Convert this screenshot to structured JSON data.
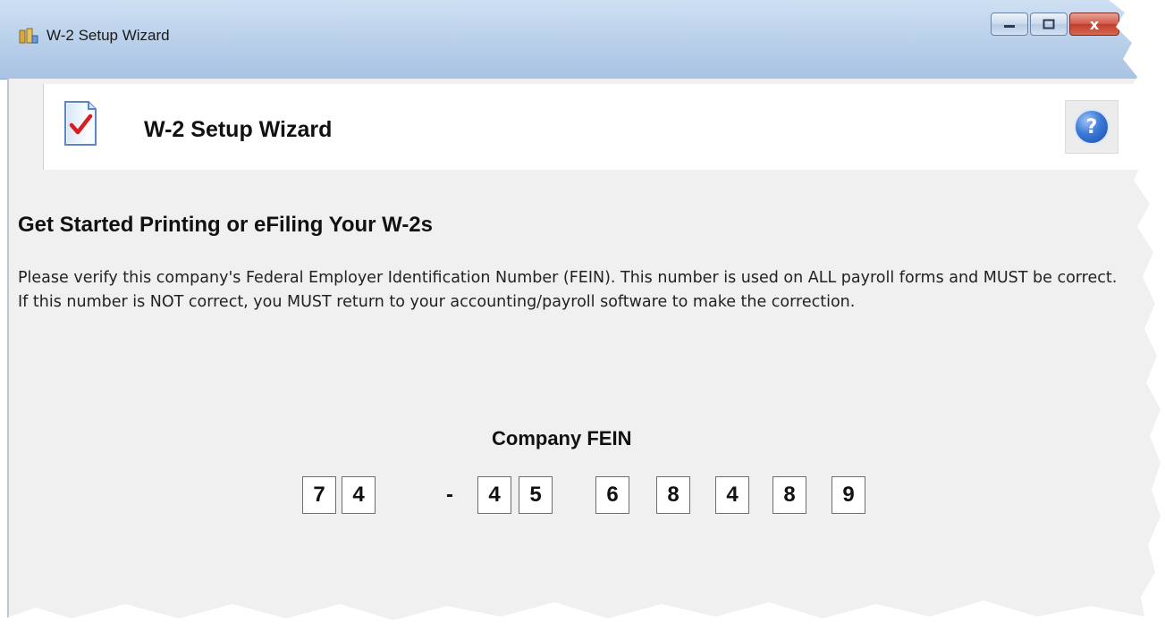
{
  "window": {
    "title": "W-2 Setup Wizard",
    "close_glyph": "x"
  },
  "header": {
    "title": "W-2 Setup Wizard",
    "help_glyph": "?"
  },
  "content": {
    "heading": "Get Started Printing or eFiling Your W-2s",
    "description": "Please verify this company's Federal Employer Identification Number (FEIN). This number is used on ALL payroll forms and MUST be correct. If this number is NOT correct, you MUST return to your accounting/payroll software to make the correction.",
    "fein_label": "Company FEIN",
    "fein_digits": [
      "7",
      "4",
      "4",
      "5",
      "6",
      "8",
      "4",
      "8",
      "9"
    ],
    "fein_separator": "-"
  },
  "icons": {
    "app": "w2-app-icon",
    "wizard": "checklist-icon",
    "help": "help-icon"
  },
  "colors": {
    "titlebar": "#bcd2ec",
    "client_bg": "#f0f0f0",
    "close_button": "#c23d2f",
    "help_icon": "#3b78d8"
  }
}
